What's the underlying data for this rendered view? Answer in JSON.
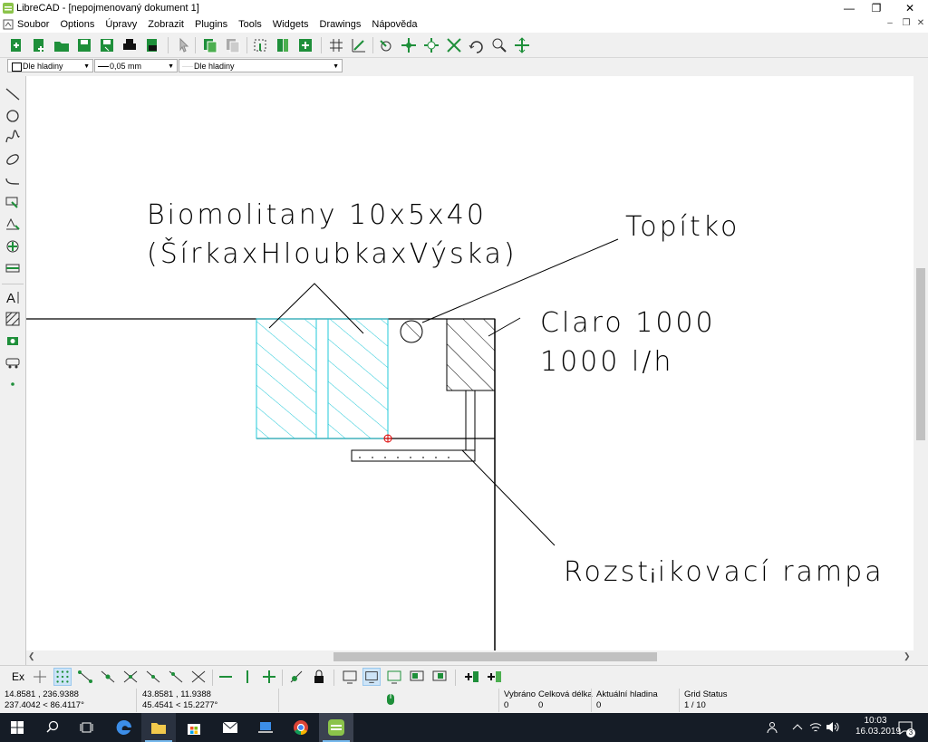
{
  "window": {
    "title": "LibreCAD - [nepojmenovaný dokument 1]"
  },
  "menu": [
    "Soubor",
    "Options",
    "Úpravy",
    "Zobrazit",
    "Plugins",
    "Tools",
    "Widgets",
    "Drawings",
    "Nápověda"
  ],
  "pen": {
    "color": "Dle hladiny",
    "width": "0,05 mm",
    "linetype": "Dle hladiny"
  },
  "drawing": {
    "label1_line1": "Biomolitany 10x5x40",
    "label1_line2": "(ŠírkaxHloubkaxVýska)",
    "label2": "Topítko",
    "label3_line1": "Claro 1000",
    "label3_line2": "1000 l/h",
    "label4": "Rozstᵢikovací rampa"
  },
  "snap": {
    "ex_label": "Ex"
  },
  "status": {
    "coord_abs": "14.8581 , 236.9388",
    "coord_abs_polar": "237.4042 < 86.4117°",
    "coord_rel": "43.8581 , 11.9388",
    "coord_rel_polar": "45.4541 < 15.2277°",
    "selected_label": "Vybráno",
    "selected_value": "0",
    "total_length_label": "Celková délka",
    "total_length_value": "0",
    "layer_label": "Aktuální hladina",
    "layer_value": "0",
    "grid_label": "Grid Status",
    "grid_value": "1 / 10"
  },
  "taskbar": {
    "time": "10:03",
    "date": "16.03.2019",
    "notifications": "3"
  },
  "colors": {
    "hatch": "#22c8d8",
    "taskbar": "#151c26",
    "accent": "#1e8f3a"
  }
}
